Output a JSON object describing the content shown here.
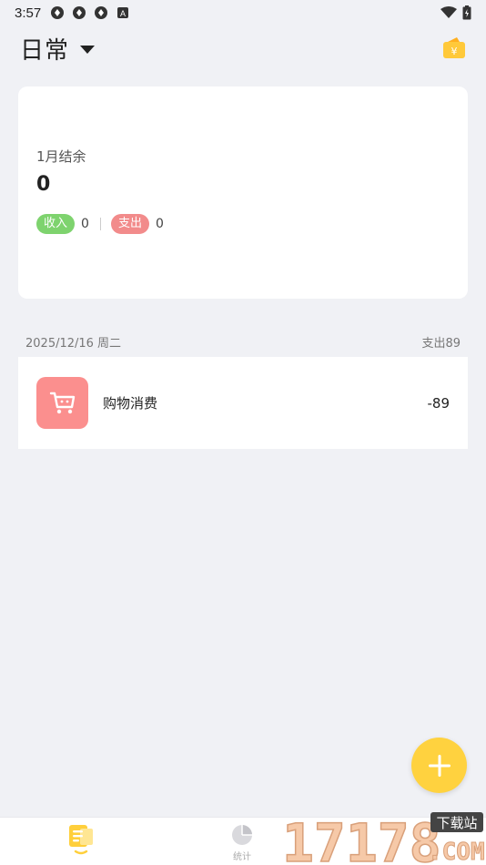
{
  "status_bar": {
    "time": "3:57",
    "icons": [
      "app-notification-icon",
      "app-notification-icon",
      "app-notification-icon",
      "a-badge-icon",
      "wifi-icon",
      "battery-icon"
    ]
  },
  "header": {
    "book_name": "日常",
    "dropdown_icon": "caret-down-icon",
    "wallet_icon": "wallet-icon"
  },
  "summary": {
    "label": "1月结余",
    "balance": "0",
    "income_label": "收入",
    "income_value": "0",
    "expense_label": "支出",
    "expense_value": "0"
  },
  "day_group": {
    "date": "2025/12/16 周二",
    "total": "支出89",
    "records": [
      {
        "category": "购物消费",
        "amount": "-89",
        "icon": "shopping-cart-icon"
      }
    ]
  },
  "fab": {
    "icon": "plus-icon"
  },
  "bottom_nav": {
    "items": [
      {
        "label": "",
        "icon": "ledger-icon",
        "active": true
      },
      {
        "label": "统计",
        "icon": "pie-chart-icon",
        "active": false
      }
    ]
  },
  "watermark": {
    "text": "17178",
    "badge": "下载站",
    "domain": ".COM"
  },
  "colors": {
    "accent": "#ffd23f",
    "income": "#7ed36e",
    "expense": "#f28b8b",
    "category_shopping": "#fb8f8e",
    "background": "#f0f1f5"
  }
}
